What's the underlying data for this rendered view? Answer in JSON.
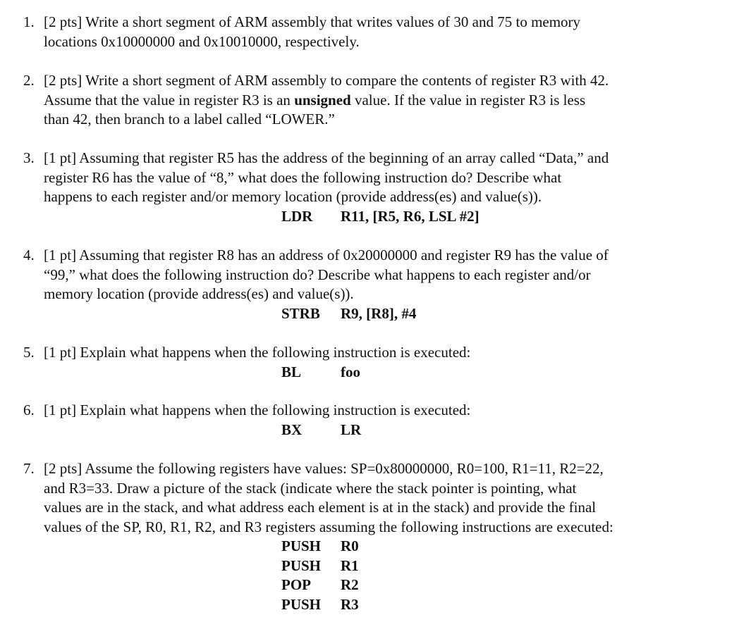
{
  "questions": [
    {
      "number": "1.",
      "lines": [
        "[2 pts] Write a short segment of ARM assembly that writes values of 30 and 75 to memory",
        "locations 0x10000000 and 0x10010000, respectively."
      ],
      "code": []
    },
    {
      "number": "2.",
      "lines": [
        "[2 pts] Write a short segment of ARM assembly to compare the contents of register R3 with 42.",
        {
          "before": "Assume that the value in register R3 is an ",
          "bold": "unsigned",
          "after": " value.  If the value in register R3 is less"
        },
        "than 42, then branch to a label called “LOWER.”"
      ],
      "code": []
    },
    {
      "number": "3.",
      "lines": [
        "[1 pt] Assuming that register R5 has the address of the beginning of an array called “Data,” and",
        "register R6 has the value of “8,” what does the following instruction do?  Describe what",
        "happens to each register and/or memory location (provide address(es) and value(s))."
      ],
      "code": [
        {
          "op": "LDR",
          "args": "R11, [R5, R6, LSL #2]"
        }
      ]
    },
    {
      "number": "4.",
      "lines": [
        "[1 pt] Assuming that register R8 has an address of 0x20000000 and register R9 has the value of",
        "“99,” what does the following instruction do?  Describe what happens to each register and/or",
        "memory location (provide address(es) and value(s))."
      ],
      "code": [
        {
          "op": "STRB",
          "args": "R9, [R8], #4"
        }
      ]
    },
    {
      "number": "5.",
      "lines": [
        "[1 pt] Explain what happens when the following instruction is executed:"
      ],
      "code": [
        {
          "op": "BL",
          "args": "foo"
        }
      ]
    },
    {
      "number": "6.",
      "lines": [
        "[1 pt] Explain what happens when the following instruction is executed:"
      ],
      "code": [
        {
          "op": "BX",
          "args": "LR"
        }
      ]
    },
    {
      "number": "7.",
      "lines": [
        "[2 pts] Assume the following registers have values: SP=0x80000000, R0=100, R1=11, R2=22,",
        "and R3=33.  Draw a picture of the stack (indicate where the stack pointer is pointing, what",
        "values are in the stack, and what address each element is at in the stack) and provide the final",
        "values of the SP, R0, R1, R2, and R3 registers assuming the following instructions are executed:"
      ],
      "code": [
        {
          "op": "PUSH",
          "args": "R0"
        },
        {
          "op": "PUSH",
          "args": "R1"
        },
        {
          "op": "POP",
          "args": "R2"
        },
        {
          "op": "PUSH",
          "args": "R3"
        }
      ]
    }
  ]
}
